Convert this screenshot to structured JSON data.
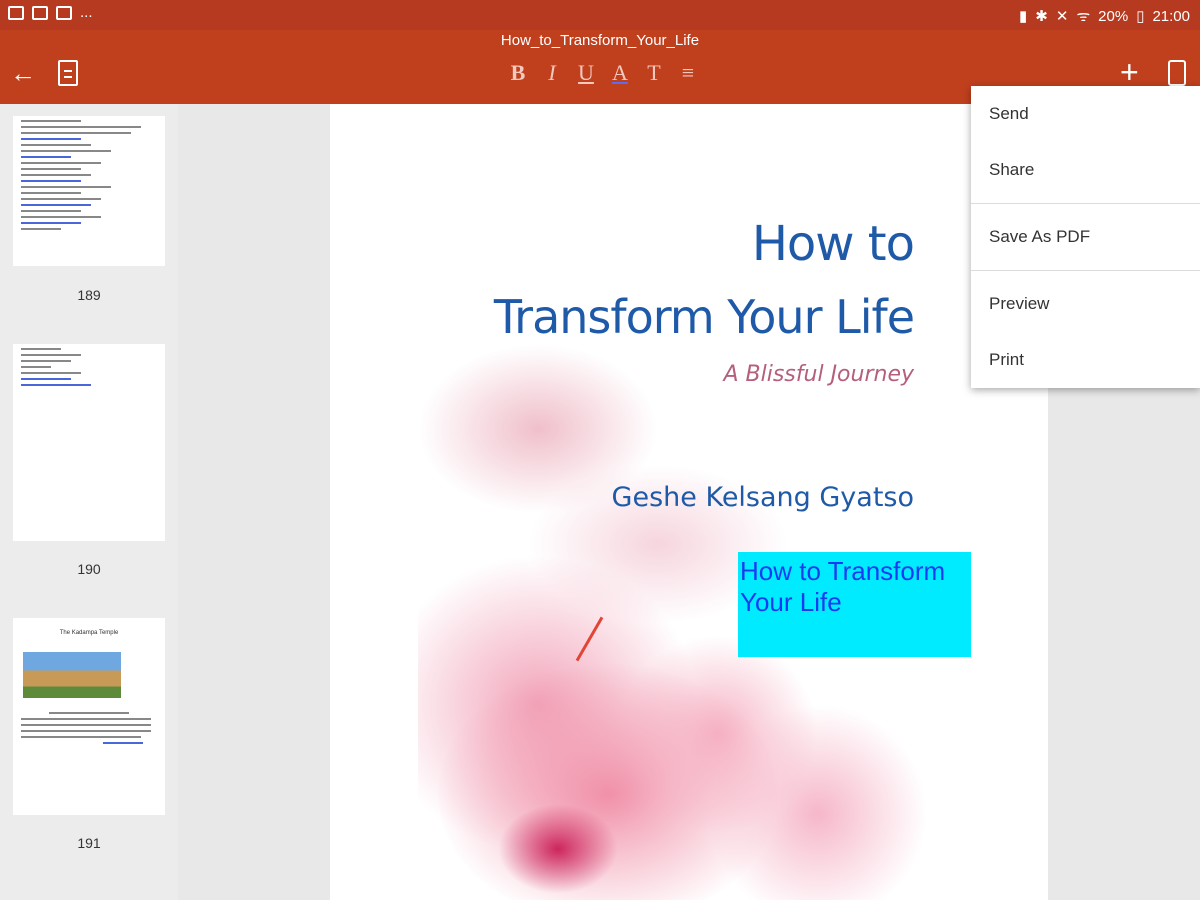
{
  "status_bar": {
    "battery": "20%",
    "time": "21:00",
    "overflow": "..."
  },
  "app_bar": {
    "title": "How_to_Transform_Your_Life",
    "format_buttons": [
      "B",
      "I",
      "U",
      "A",
      "T",
      "≡"
    ],
    "icons": [
      "back-arrow-icon",
      "page-icon",
      "plus-icon",
      "more-icon"
    ],
    "color": "#c0401e"
  },
  "thumbnails": [
    {
      "page": "189"
    },
    {
      "page": "190"
    },
    {
      "page": "191",
      "heading": "The Kadampa Temple"
    }
  ],
  "document": {
    "title_line1": "How to",
    "title_line2": "Transform Your Life",
    "subtitle": "A Blissful Journey",
    "author": "Geshe  Kelsang Gyatso",
    "textbox_text": "How to Transform Your Life"
  },
  "overflow_menu": {
    "items": [
      "Send",
      "Share",
      "Save As PDF",
      "Preview",
      "Print"
    ]
  }
}
